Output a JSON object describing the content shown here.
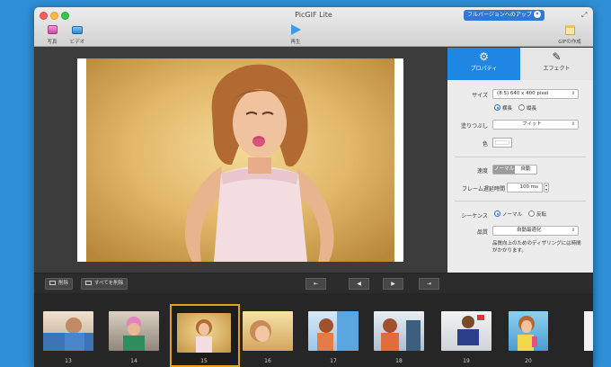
{
  "window": {
    "title": "PicGIF Lite",
    "upgrade_label": "フルバージョンへのアップ",
    "upgrade_chevron": "▾",
    "fullscreen_glyph": "⤢"
  },
  "toolbar": {
    "photo_label": "写真",
    "video_label": "ビデオ",
    "play_label": "再生",
    "gif_label": "GIFの作成"
  },
  "panel": {
    "tab_properties": "プロパティ",
    "tab_properties_icon": "⚙",
    "tab_effect": "エフェクト",
    "tab_effect_icon": "✎",
    "size_label": "サイズ",
    "size_value": "(8:5) 640 x 400 pixel",
    "orient_landscape": "横長",
    "orient_portrait": "縦長",
    "fill_label": "塗りつぶし",
    "fill_value": "フィット",
    "color_label": "色",
    "speed_label": "速度",
    "speed_normal": "ノーマル",
    "speed_auto": "自動",
    "delay_label": "フレーム遅延時間",
    "delay_value": "100 ms",
    "sequence_label": "シーケンス",
    "sequence_normal": "ノーマル",
    "sequence_reverse": "反転",
    "quality_label": "品質",
    "quality_value": "自動最適化",
    "quality_note": "品質向上のためのディザリングには時間がかかります。"
  },
  "controls": {
    "delete_label": "削除",
    "delete_all_label": "すべてを削除",
    "first_glyph": "⇤",
    "prev_glyph": "◀",
    "next_glyph": "▶",
    "last_glyph": "⇥"
  },
  "filmstrip": {
    "frames": [
      {
        "number": "13"
      },
      {
        "number": "14"
      },
      {
        "number": "15"
      },
      {
        "number": "16"
      },
      {
        "number": "17"
      },
      {
        "number": "18"
      },
      {
        "number": "19"
      },
      {
        "number": "20"
      }
    ],
    "selected_number": "15"
  },
  "colors": {
    "accent": "#1f86e4",
    "selection": "#d9a520"
  }
}
